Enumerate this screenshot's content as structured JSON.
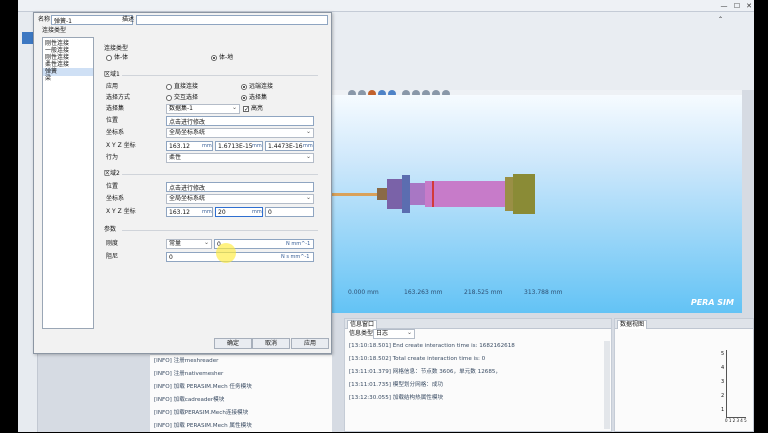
{
  "dialog": {
    "name_label": "名称",
    "name_value": "弹簧-1",
    "desc_label": "描述",
    "desc_value": "",
    "conn_type_label": "连接类型",
    "conn_types": [
      "刚性连接",
      "一般连接",
      "刚性连接",
      "柔性连接",
      "弹簧",
      "梁"
    ],
    "selected_index": 4,
    "conn_category": {
      "label": "连接类型",
      "options": [
        "体-体",
        "体-地"
      ],
      "selected": "体-地"
    },
    "region1": {
      "title": "区域1",
      "apply_label": "应用",
      "apply_options": [
        "直接连接",
        "远端连接"
      ],
      "apply_selected": "远端连接",
      "select_mode_label": "选择方式",
      "select_mode_options": [
        "交互选择",
        "选择集"
      ],
      "select_mode_selected": "选择集",
      "select_set_label": "选择集",
      "select_set_value": "数据集-1",
      "highlight_label": "高亮",
      "position_label": "位置",
      "position_value": "点击进行修改",
      "coord_label": "坐标系",
      "coord_value": "全局坐标系统",
      "xyz_label": "X Y Z 坐标",
      "xyz": [
        "163.12",
        "1.6713E-15",
        "1.4473E-16"
      ],
      "unit": "mm",
      "behavior_label": "行为",
      "behavior_value": "柔性"
    },
    "region2": {
      "title": "区域2",
      "position_label": "位置",
      "position_value": "点击进行修改",
      "coord_label": "坐标系",
      "coord_value": "全局坐标系统",
      "xyz_label": "X Y Z 坐标",
      "xyz": [
        "163.12",
        "20",
        "0"
      ],
      "unit": "mm"
    },
    "params": {
      "title": "参数",
      "stiffness_label": "刚度",
      "stiffness_mode": "常量",
      "stiffness_value": "0",
      "stiffness_unit": "N mm^-1",
      "damping_label": "阻尼",
      "damping_value": "0",
      "damping_unit": "N s mm^-1"
    },
    "buttons": {
      "ok": "确定",
      "cancel": "取消",
      "apply": "应用"
    }
  },
  "viewport": {
    "scale_labels": [
      "0.000 mm",
      "163.263 mm",
      "218.525 mm",
      "313.788 mm"
    ],
    "brand": "PERA SIM"
  },
  "info_panel": {
    "tab": "信息窗口",
    "filter_label": "信息类型",
    "filter_value": "日志",
    "lines": [
      "[13:10:18.501] End create interaction time is: 1682162618",
      "[13:10:18.502] Total create interaction time is: 0",
      "[13:11:01.379] 网格信息：节点数 3606，单元数 12685，",
      "[13:11:01.735] 模型划分网格：成功",
      "[13:12:30.055] 加载结构热属性模块"
    ]
  },
  "data_panel": {
    "tab": "数据视图",
    "yticks": [
      "5",
      "4",
      "3",
      "2",
      "1"
    ],
    "xticks": "0 1 2 3 4 5"
  },
  "left_log": [
    "[INFO] 注册meshreader",
    "[INFO] 注册nativemesher",
    "[INFO] 加载 PERASIM.Mech 任务模块",
    "[INFO] 加载cadreader模块",
    "[INFO] 加载PERASIM.Mech连接模块",
    "[INFO] 加载 PERASIM.Mech 属性模块"
  ],
  "colors": {
    "accent": "#1e6fd0",
    "viewport_top": "#f6fbff",
    "viewport_bottom": "#63c3f5",
    "log_green": "#2d7d2a"
  }
}
